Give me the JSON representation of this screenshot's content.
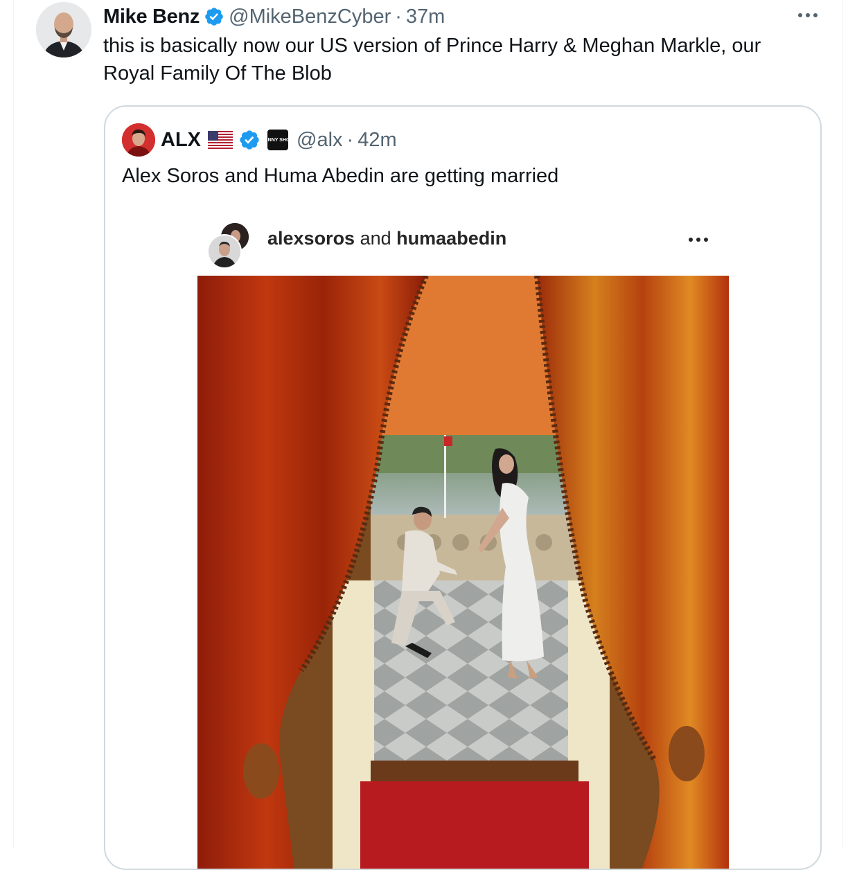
{
  "tweet": {
    "author_name": "Mike Benz",
    "handle": "@MikeBenzCyber",
    "separator": "·",
    "time": "37m",
    "text": "this is basically now our US version of Prince Harry & Meghan Markle, our Royal Family Of The Blob",
    "icons": {
      "verified": "verified-badge-icon",
      "more": "more-options-icon"
    }
  },
  "quote": {
    "author_name": "ALX",
    "handle": "@alx",
    "separator": "·",
    "time": "42m",
    "text": "Alex Soros and Huma Abedin are getting married",
    "benny_logo_text": "BENNY SHOW",
    "icons": {
      "flag": "us-flag-icon",
      "verified": "verified-badge-icon",
      "affiliate": "benny-show-logo-icon"
    }
  },
  "instagram_embed": {
    "user1": "alexsoros",
    "joiner": "and",
    "user2": "humaabedin",
    "icons": {
      "more": "more-options-icon"
    }
  },
  "colors": {
    "text_primary": "#0f1419",
    "text_secondary": "#536471",
    "verified_blue": "#1d9bf0",
    "border": "#cfd9de"
  }
}
